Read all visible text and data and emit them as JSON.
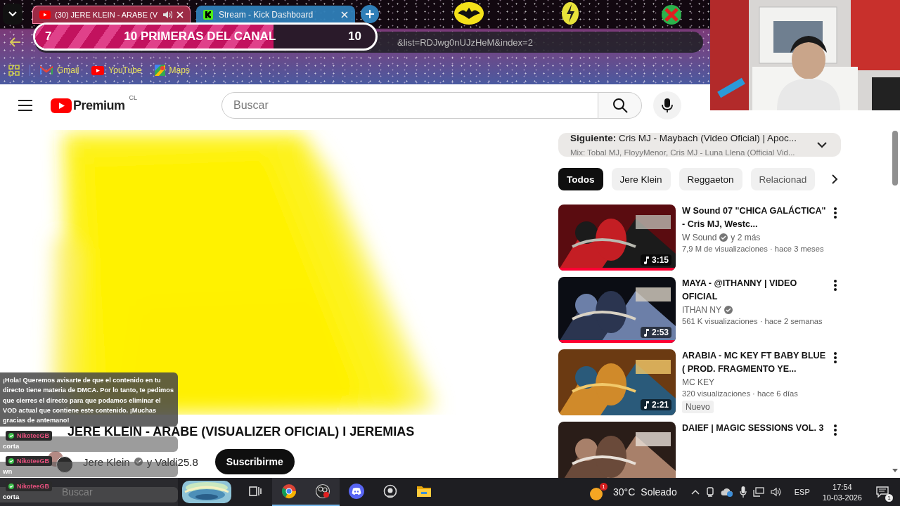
{
  "browser": {
    "tabs": [
      {
        "title": "(30) JERE KLEIN - ARABE (V",
        "selected": true,
        "kind": "youtube",
        "audio": true
      },
      {
        "title": "Stream - Kick Dashboard",
        "selected": false,
        "kind": "kick",
        "audio": false
      }
    ],
    "url": "&list=RDJwg0nUJzHeM&index=2",
    "bookmarks": [
      {
        "label": "Gmail",
        "kind": "gmail"
      },
      {
        "label": "YouTube",
        "kind": "youtube"
      },
      {
        "label": "Maps",
        "kind": "maps"
      }
    ]
  },
  "goal_overlay": {
    "current": "7",
    "title": "10 PRIMERAS DEL CANAL",
    "target": "10",
    "level": 0.7
  },
  "youtube": {
    "logo": "Premium",
    "region": "CL",
    "search": {
      "placeholder": "Buscar"
    },
    "video": {
      "title": "JERE KLEIN - ARABE (VISUALIZER OFICIAL) I JEREMIAS",
      "channel": "Jere Klein",
      "coauthors": "y Valdi25.8",
      "subscribe": "Suscribirme"
    },
    "up_next": {
      "label": "Siguiente:",
      "title": "Cris MJ - Maybach (Video Oficial) | Apoc...",
      "mix": "Mix: Tobal MJ, FloyyMenor, Cris MJ - Luna Llena (Official Vid..."
    },
    "chips": [
      {
        "label": "Todos",
        "selected": true
      },
      {
        "label": "Jere Klein",
        "selected": false
      },
      {
        "label": "Reggaeton",
        "selected": false
      },
      {
        "label": "Relacionad",
        "selected": false
      }
    ],
    "recommendations": [
      {
        "title": "W Sound 07 \"CHICA GALÁCTICA\" - Cris MJ, Westc...",
        "channel": "W Sound",
        "verified": true,
        "extra": "y 2 más",
        "stats": "7,9 M de visualizaciones · hace 3 meses",
        "duration": "3:15",
        "level": 1
      },
      {
        "title": "MAYA - @ITHANNY  | VIDEO OFICIAL",
        "channel": "ITHAN NY",
        "verified": true,
        "stats": "561 K visualizaciones · hace 2 semanas",
        "duration": "2:53",
        "level": 1
      },
      {
        "title": "ARABIA -  MC KEY FT BABY BLUE ( PROD. FRAGMENTO YE...",
        "channel": "MC KEY",
        "verified": false,
        "stats": "320 visualizaciones · hace 6 días",
        "duration": "2:21",
        "badge": "Nuevo"
      },
      {
        "title": "DAIEF | MAGIC SESSIONS VOL. 3"
      }
    ]
  },
  "chat": [
    {
      "kind": "notice",
      "text": "¡Hola! Queremos avisarte de que el contenido en tu directo tiene materia de DMCA. Por lo tanto, te pedimos que cierres el directo para que podamos eliminar el VOD actual que contiene este contenido. ¡Muchas gracias de antemano!"
    },
    {
      "kind": "message",
      "user": "NikoteeGB",
      "text": "corta"
    },
    {
      "kind": "message",
      "user": "NikoteeGB",
      "text": "wn"
    },
    {
      "kind": "message",
      "user": "NikoteeGB",
      "text": "corta"
    }
  ],
  "taskbar": {
    "search": {
      "placeholder": "Buscar"
    },
    "apps": [
      {
        "kind": "taskview",
        "open": false
      },
      {
        "kind": "chrome",
        "open": true
      },
      {
        "kind": "obs",
        "open": true
      },
      {
        "kind": "discord",
        "open": false
      },
      {
        "kind": "webcam",
        "open": false
      },
      {
        "kind": "folder",
        "open": false
      }
    ],
    "weather": {
      "badge": "1",
      "temp": "30°C",
      "condition": "Soleado"
    },
    "language": "ESP",
    "time": "17:54",
    "date": "10-03-2026",
    "notifications": "1"
  }
}
